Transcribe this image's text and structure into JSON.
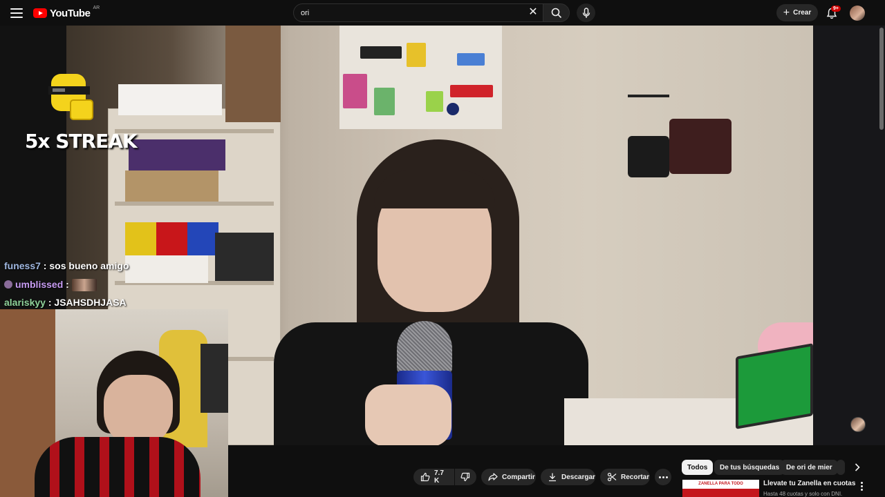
{
  "header": {
    "logo_text": "YouTube",
    "region": "AR",
    "search_value": "ori",
    "create_label": "Crear",
    "notifications_badge": "9+"
  },
  "overlay": {
    "streak_text": "5x STREAK",
    "chat": [
      {
        "user": "funess7",
        "message": "sos bueno amigo"
      },
      {
        "user": "umblissed",
        "message": ""
      },
      {
        "user": "alariskyy",
        "message": "JSAHSDHJASA"
      }
    ]
  },
  "actions": {
    "like_count": "7.7 K",
    "share_label": "Compartir",
    "download_label": "Descargar",
    "clip_label": "Recortar"
  },
  "chips": [
    "Todos",
    "De tus búsquedas",
    "De ori de mier"
  ],
  "ad": {
    "thumb_text": "ZANELLA PARA TODO",
    "title": "Llevate tu Zanella en cuotas",
    "subtitle": "Hasta 48 cuotas y solo con DNI."
  },
  "colors": {
    "background": "#0f0f0f",
    "pill": "#272727",
    "brand_red": "#ff0000",
    "badge_red": "#cc0000"
  }
}
